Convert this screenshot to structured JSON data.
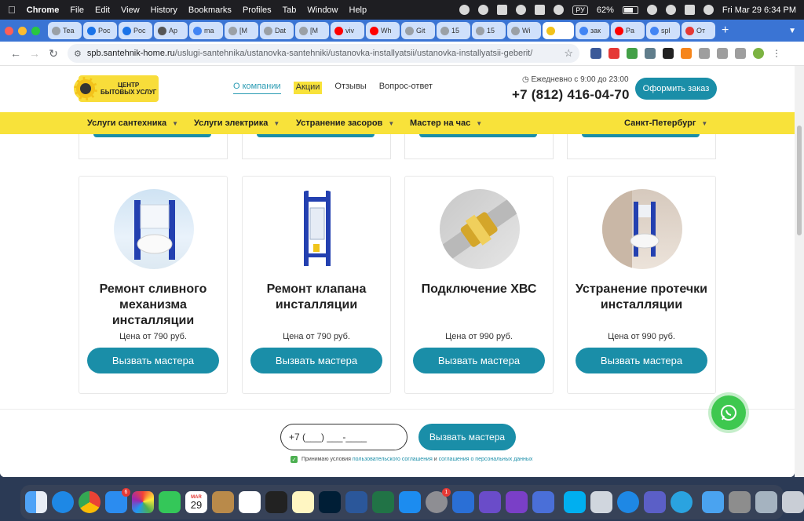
{
  "menubar": {
    "app": "Chrome",
    "items": [
      "File",
      "Edit",
      "View",
      "History",
      "Bookmarks",
      "Profiles",
      "Tab",
      "Window",
      "Help"
    ],
    "keyboard": "РУ",
    "battery": "62%",
    "clock": "Fri Mar 29  6:34 PM"
  },
  "tabs": [
    {
      "label": "Tea",
      "color": "#9aa0a6"
    },
    {
      "label": "Poc",
      "color": "#1a73e8"
    },
    {
      "label": "Poc",
      "color": "#1a73e8"
    },
    {
      "label": "Ap",
      "color": "#555555"
    },
    {
      "label": "ma",
      "color": "#4285f4"
    },
    {
      "label": "[M",
      "color": "#9aa0a6"
    },
    {
      "label": "Dat",
      "color": "#9aa0a6"
    },
    {
      "label": "[M",
      "color": "#9aa0a6"
    },
    {
      "label": "viv",
      "color": "#ff0000"
    },
    {
      "label": "Wh",
      "color": "#ff0000"
    },
    {
      "label": "Git",
      "color": "#9aa0a6"
    },
    {
      "label": "15",
      "color": "#9aa0a6"
    },
    {
      "label": "15",
      "color": "#9aa0a6"
    },
    {
      "label": "Wi",
      "color": "#9aa0a6"
    },
    {
      "label": "",
      "color": "#f3c21a"
    },
    {
      "label": "зак",
      "color": "#4285f4"
    },
    {
      "label": "Pa",
      "color": "#ff0000"
    },
    {
      "label": "spl",
      "color": "#4285f4"
    },
    {
      "label": "От",
      "color": "#e53935"
    }
  ],
  "address": {
    "host": "spb.santehnik-home.ru",
    "path": "/uslugi-santehnika/ustanovka-santehniki/ustanovka-installyatsii/ustanovka-installyatsii-geberit/"
  },
  "site": {
    "logo_line1": "ЦЕНТР",
    "logo_line2": "БЫТОВЫХ УСЛУГ",
    "nav": {
      "about": "О компании",
      "promo": "Акции",
      "reviews": "Отзывы",
      "faq": "Вопрос-ответ"
    },
    "hours": "Ежедневно с 9:00 до 23:00",
    "phone": "+7 (812) 416-04-70",
    "order_button": "Оформить заказ",
    "categories": [
      {
        "label": "Услуги сантехника"
      },
      {
        "label": "Услуги электрика"
      },
      {
        "label": "Устранение засоров"
      },
      {
        "label": "Мастер на час"
      },
      {
        "label": "Санкт-Петербург"
      }
    ]
  },
  "cards": [
    {
      "title": "Ремонт сливного механизма инсталляции",
      "price": "Цена от 790 руб.",
      "cta": "Вызвать мастера"
    },
    {
      "title": "Ремонт клапана инсталляции",
      "price": "Цена от 790 руб.",
      "cta": "Вызвать мастера"
    },
    {
      "title": "Подключение ХВС",
      "price": "Цена от 990 руб.",
      "cta": "Вызвать мастера"
    },
    {
      "title": "Устранение протечки инсталляции",
      "price": "Цена от 990 руб.",
      "cta": "Вызвать мастера"
    }
  ],
  "form": {
    "phone_placeholder": "+7 (___) ___-____",
    "submit": "Вызвать мастера",
    "consent_prefix": "Принимаю условия",
    "consent_link1": "пользовательского соглашения",
    "consent_and": "и",
    "consent_link2": "соглашения о персональных данных"
  },
  "dock": {
    "calendar_month": "MAR",
    "calendar_day": "29",
    "mail_badge": "6",
    "settings_badge": "1"
  },
  "colors": {
    "accent": "#1a8ea8",
    "brand_yellow": "#f8e23a",
    "whatsapp": "#3ec84f"
  }
}
